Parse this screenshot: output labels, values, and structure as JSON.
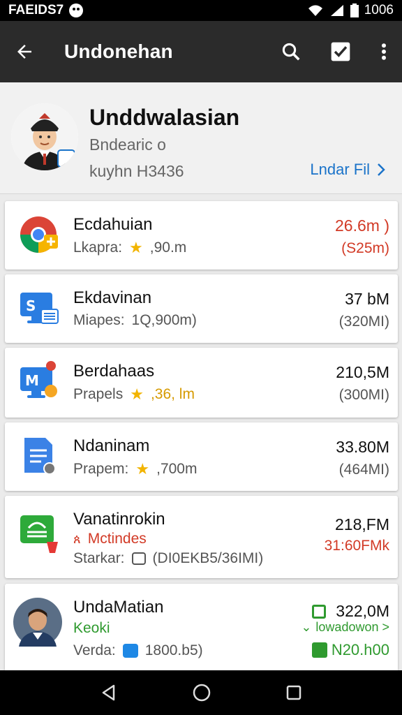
{
  "status_bar": {
    "left_text": "FAEIDS7",
    "time": "1006"
  },
  "app_bar": {
    "title": "Undonehan",
    "back_icon": "arrow-back-icon",
    "search_icon": "search-icon",
    "check_icon": "check-box-icon",
    "more_icon": "more-vert-icon"
  },
  "profile": {
    "name": "Unddwalasian",
    "subtitle": "Bndearic o",
    "meta": "kuyhn H3436",
    "link_label": "Lndar Fil"
  },
  "items": [
    {
      "title": "Ecdahuian",
      "prefix": "Lkapra:",
      "detail": ",90.m",
      "right_top": "26.6m )",
      "right_bottom": "(S25m)"
    },
    {
      "title": "Ekdavinan",
      "prefix": "Miapes:",
      "detail": "1Q,900m)",
      "right_top": "37 bM",
      "right_bottom": "(320MI)"
    },
    {
      "title": "Berdahaas",
      "prefix": "Prapels",
      "detail": ",36, lm",
      "right_top": "210,5M",
      "right_bottom": "(300MI)"
    },
    {
      "title": "Ndaninam",
      "prefix": "Prapem:",
      "detail": ",700m",
      "right_top": "33.80M",
      "right_bottom": "(464MI)"
    },
    {
      "title": "Vanatinrokin",
      "tag": "Mctindes",
      "prefix": "Starkar:",
      "detail": "(DI0EKB5/36IMI)",
      "right_top": "218,FM",
      "right_bottom": "31:60FMk"
    },
    {
      "title": "UndaMatian",
      "tag": "Keoki",
      "prefix": "Verda:",
      "detail": "1800.b5)",
      "right_top": "322,0M",
      "right_mid": "lowadowon >",
      "right_bottom": "N20.h00"
    }
  ],
  "colors": {
    "accent_red": "#d23a26",
    "accent_blue": "#1a73c9",
    "accent_green": "#2f9a2f",
    "star": "#f2b400"
  }
}
